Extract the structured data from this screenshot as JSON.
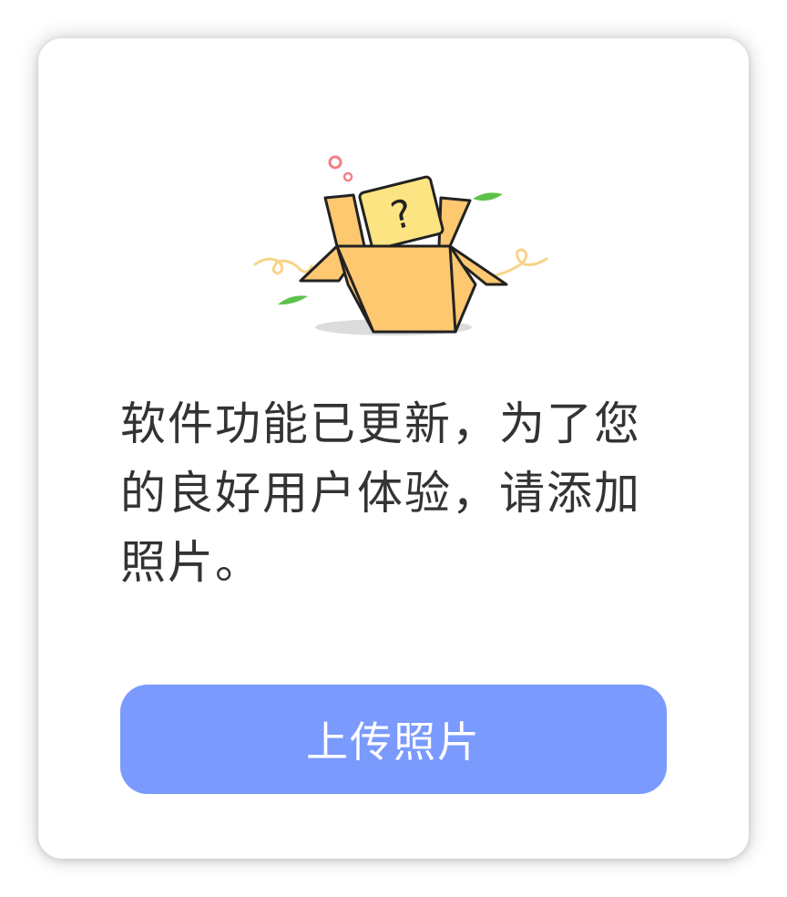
{
  "dialog": {
    "illustration_icon": "open-box-question-icon",
    "message": "软件功能已更新，为了您的良好用户体验，请添加照片。",
    "upload_button_label": "上传照片"
  },
  "colors": {
    "button": "#7a9afe",
    "box": "#fdc870",
    "card": "#fde482",
    "text": "#333333"
  }
}
